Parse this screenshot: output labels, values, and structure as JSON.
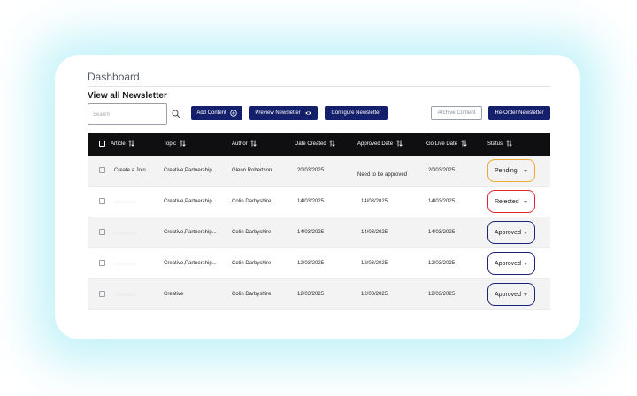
{
  "dashboard_title": "Dashboard",
  "section_title": "View all Newsletter",
  "search": {
    "placeholder": "Search",
    "value": ""
  },
  "toolbar": {
    "add_content": "Add Content",
    "preview_newsletter": "Preview Newsletter",
    "configure_newsletter": "Configure Newsletter",
    "archive_content": "Archive Content",
    "reorder_newsletter": "Re-Order Newsletter"
  },
  "columns": [
    "Article",
    "Topic",
    "Author",
    "Date Created",
    "Approved Date",
    "Go Live Date",
    "Status"
  ],
  "status_colors": {
    "Pending": "#f0a830",
    "Rejected": "#e0262d",
    "Approved": "#1b237a"
  },
  "rows": [
    {
      "article": "Create a Join...",
      "article_blurred": false,
      "topic": "Creative,Partnership...",
      "author": "Glenn Robertson",
      "date_created": "20/03/2025",
      "approved_date": "Need to be approved",
      "go_live_date": "20/03/2025",
      "status": "Pending"
    },
    {
      "article": "...............",
      "article_blurred": true,
      "topic": "Creative,Partnership...",
      "author": "Colin Darbyshire",
      "date_created": "14/03/2025",
      "approved_date": "14/03/2025",
      "go_live_date": "14/03/2025",
      "status": "Rejected"
    },
    {
      "article": "...............",
      "article_blurred": true,
      "topic": "Creative,Partnership...",
      "author": "Colin Darbyshire",
      "date_created": "14/03/2025",
      "approved_date": "14/03/2025",
      "go_live_date": "14/03/2025",
      "status": "Approved"
    },
    {
      "article": "...............",
      "article_blurred": true,
      "topic": "Creative,Partnership...",
      "author": "Colin Darbyshire",
      "date_created": "12/03/2025",
      "approved_date": "12/03/2025",
      "go_live_date": "12/03/2025",
      "status": "Approved"
    },
    {
      "article": "...............",
      "article_blurred": true,
      "topic": "Creative",
      "author": "Colin Darbyshire",
      "date_created": "12/03/2025",
      "approved_date": "12/03/2025",
      "go_live_date": "12/03/2025",
      "status": "Approved"
    }
  ],
  "icons": {
    "search": "search-icon",
    "add": "plus-circle-icon",
    "preview": "eye-icon",
    "sort": "sort-arrows-icon",
    "dropdown": "chevron-down-icon"
  }
}
